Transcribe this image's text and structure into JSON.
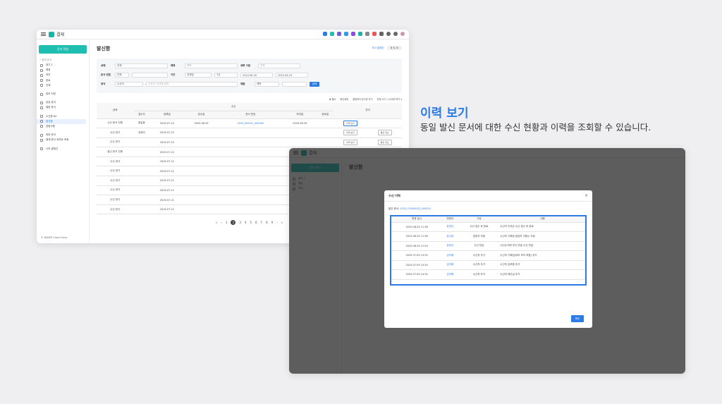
{
  "caption": {
    "title": "이력 보기",
    "desc": "동일 발신 문서에 대한 수신 현황과 이력을 조회할 수 있습니다."
  },
  "app": {
    "name": "결재",
    "write_btn": "문서 작성",
    "footer": "© NAVER Cloud Corp."
  },
  "sidebar": {
    "group": "• 결재 문서",
    "items": [
      "대기 1",
      "예정",
      "처리",
      "완료",
      "전체"
    ],
    "items2": [
      "참조 저장"
    ],
    "items3": [
      "공유 문서",
      "열람 문서"
    ],
    "items4": [
      "수신함 64",
      "발신함",
      "공람사항"
    ],
    "items5": [
      "위한 문서",
      "결재 문서 외부로 조회"
    ],
    "items6": [
      "나의 결재선"
    ]
  },
  "page": {
    "title": "발신함",
    "right_link": "부서 결재선",
    "icons": "⚙ ⇅ ⚙"
  },
  "filters": {
    "status_l": "상태",
    "status_v": "전체",
    "title_l": "제목",
    "title_ph": "제목",
    "att_l": "세부 구분",
    "att_v": "전체",
    "docno_l": "문서 번호",
    "docno_v": "전체",
    "period_l": "기간",
    "period_v": "전체일",
    "period2": "1년",
    "date1": "2024.08.30",
    "date2": "2025.08.29",
    "form_l": "양식",
    "form_v": "수신처",
    "form_ph": "수신처, 부서명 검색",
    "ref_l": "재출",
    "ref_v": "제목",
    "search": "검색"
  },
  "toolbar": {
    "filter": "▼ 필터",
    "opt1": "회신제외",
    "opt2": "결재하지 문서만 보기",
    "count": "전체 137 | 10개씩 보기 ▾"
  },
  "table": {
    "h_status": "상태",
    "h_group": "수신",
    "h_cols": [
      "접수자",
      "등록일",
      "접수일",
      "문서 번호",
      "처리일",
      "완료일"
    ],
    "h_action": "관리",
    "rows": [
      {
        "s": "수신 문서 진행",
        "a": "홍길동",
        "r": "2025.07.22",
        "c": "2025.08.29",
        "n": "2025_BOV01_000000",
        "p": "2025.08.29",
        "btn": "이력 보기",
        "btn2": ""
      },
      {
        "s": "수신 대기",
        "a": "유재석",
        "r": "2025.07.22",
        "c": "",
        "n": "",
        "p": "",
        "btn": "이력 보기",
        "btn2": "발신 취소"
      },
      {
        "s": "수신 대기",
        "a": "",
        "r": "2025.07.22",
        "c": "",
        "n": "",
        "p": "",
        "btn": "이력 보기",
        "btn2": "발신 취소"
      },
      {
        "s": "발신 문서 진행",
        "a": "",
        "r": "2025.07.22",
        "c": "",
        "n": "",
        "p": "",
        "btn": "",
        "btn2": ""
      },
      {
        "s": "수신 대기",
        "a": "",
        "r": "2025.07.21",
        "c": "",
        "n": "",
        "p": "",
        "btn": "",
        "btn2": ""
      },
      {
        "s": "수신 대기",
        "a": "",
        "r": "2025.07.21",
        "c": "",
        "n": "",
        "p": "",
        "btn": "",
        "btn2": ""
      },
      {
        "s": "수신 대기",
        "a": "",
        "r": "2025.07.21",
        "c": "",
        "n": "",
        "p": "",
        "btn": "",
        "btn2": ""
      },
      {
        "s": "수신 대기",
        "a": "",
        "r": "2025.07.21",
        "c": "",
        "n": "",
        "p": "",
        "btn": "",
        "btn2": ""
      },
      {
        "s": "수신 대기",
        "a": "",
        "r": "2025.07.21",
        "c": "",
        "n": "",
        "p": "",
        "btn": "",
        "btn2": ""
      },
      {
        "s": "수신 대기",
        "a": "",
        "r": "2025.07.21",
        "c": "",
        "n": "",
        "p": "",
        "btn": "",
        "btn2": ""
      }
    ]
  },
  "pagination": [
    "«",
    "‹",
    "1",
    "2",
    "3",
    "4",
    "5",
    "6",
    "7",
    "8",
    "9",
    "›",
    "»"
  ],
  "modal": {
    "title": "수신 이력",
    "close": "×",
    "doc_label": "발신 문서:",
    "doc_no": "2025_CS000002_000010",
    "headers": [
      "변경 일시",
      "변경자",
      "구분",
      "내용"
    ],
    "rows": [
      {
        "d": "2025.08.29 11:38",
        "u": "유미진",
        "t": "수신 접수 후 완료",
        "c": "수신자 이지은 수신 접수 후 완료"
      },
      {
        "d": "2025.08.29 11:38",
        "u": "유수정",
        "t": "접장자 지정",
        "c": "수신처 기획팀 접장자 이형수 지정"
      },
      {
        "d": "2025.08.29 11:29",
        "u": "유재석",
        "t": "수신 반송",
        "c": "(주)네 외부 부서 반송 수신 반송"
      },
      {
        "d": "2025.07.09 14:30",
        "u": "김지혜",
        "t": "수신처 추가",
        "c": "수신처 기획팀(외부 조직 포함) 추가"
      },
      {
        "d": "2025.07.09 14:30",
        "u": "김지혜",
        "t": "수신처 추가",
        "c": "수신처 김포함 추가"
      },
      {
        "d": "2025.07.09 14:30",
        "u": "김지혜",
        "t": "수신처 추가",
        "c": "수신처 예산실 추가"
      }
    ],
    "ok": "확인"
  },
  "colors": {
    "accent": "#2c7be5",
    "brand": "#1ebfb0"
  }
}
